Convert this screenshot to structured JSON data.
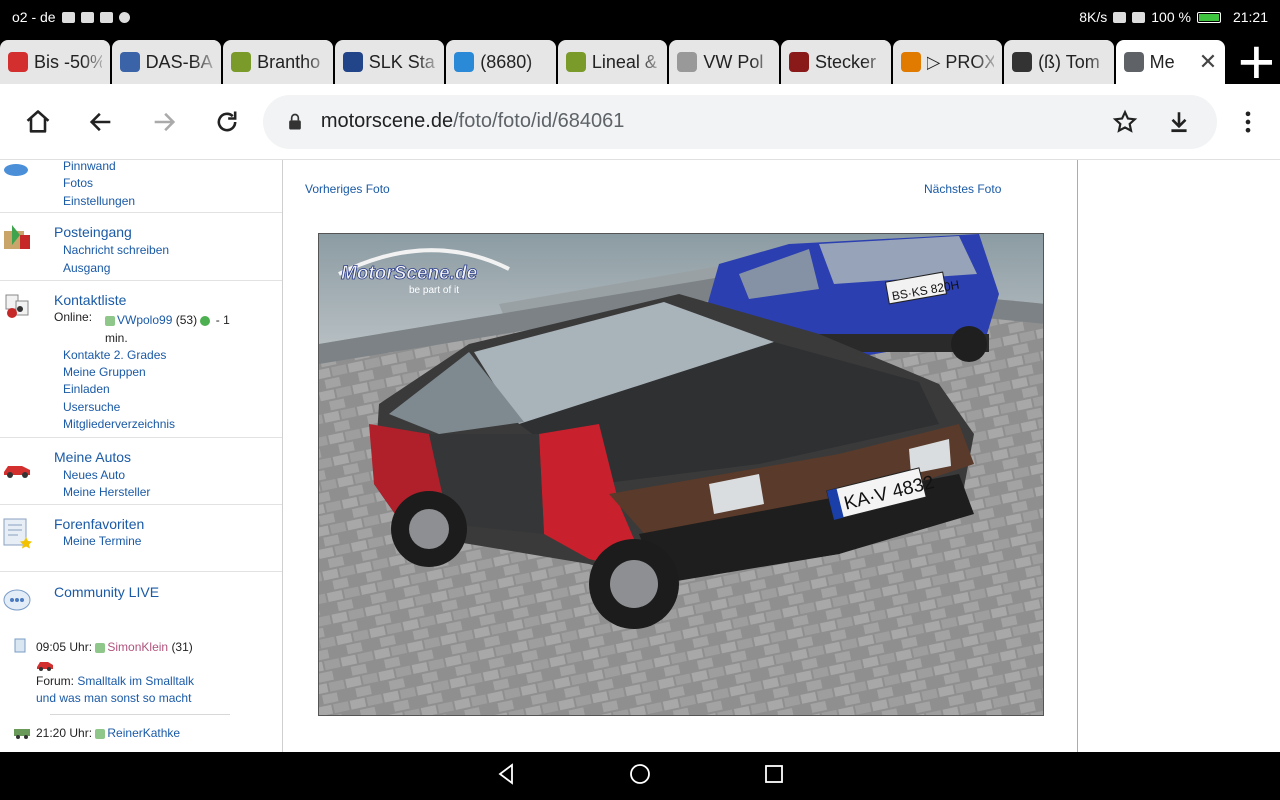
{
  "status": {
    "carrier": "o2 - de",
    "speed": "8K/s",
    "battery": "100 %",
    "time": "21:21"
  },
  "tabs": [
    {
      "title": "Bis -50%",
      "icon": "sale-icon",
      "color": "#d32f2f"
    },
    {
      "title": "DAS-BA",
      "icon": "ship-icon",
      "color": "#3a63a8"
    },
    {
      "title": "Brantho",
      "icon": "green-badge-icon",
      "color": "#7a9a2a"
    },
    {
      "title": "SLK Sta",
      "icon": "slk-icon",
      "color": "#224488"
    },
    {
      "title": "(8680)",
      "icon": "chat-icon",
      "color": "#2a8ad8"
    },
    {
      "title": "Lineal &",
      "icon": "green-badge-icon",
      "color": "#7a9a2a"
    },
    {
      "title": "VW Pol",
      "icon": "car-icon",
      "color": "#999999"
    },
    {
      "title": "Stecker",
      "icon": "xxl-icon",
      "color": "#8a1a1a"
    },
    {
      "title": "▷ PROX",
      "icon": "k-icon",
      "color": "#e07b00"
    },
    {
      "title": "(ß) Tom",
      "icon": "forum-icon",
      "color": "#333333"
    },
    {
      "title": "Me",
      "icon": "globe-icon",
      "color": "#5f6368"
    }
  ],
  "toolbar": {
    "url_host": "motorscene.de",
    "url_path": "/foto/foto/id/684061"
  },
  "sidebar": {
    "profile_links": [
      "Pinnwand",
      "Fotos",
      "Einstellungen"
    ],
    "posteingang": {
      "title": "Posteingang",
      "links": [
        "Nachricht schreiben",
        "Ausgang"
      ]
    },
    "kontakt": {
      "title": "Kontaktliste",
      "online_label": "Online:",
      "online_user": "VWpolo99",
      "online_age": "(53)",
      "online_suffix": "- 1",
      "online_min": "min.",
      "links": [
        "Kontakte 2. Grades",
        "Meine Gruppen",
        "Einladen",
        "Usersuche",
        "Mitgliederverzeichnis"
      ]
    },
    "autos": {
      "title": "Meine Autos",
      "links": [
        "Neues Auto",
        "Meine Hersteller"
      ]
    },
    "foren": {
      "title": "Forenfavoriten",
      "links": [
        "Meine Termine"
      ]
    },
    "community": {
      "title": "Community LIVE",
      "entry1_time": "09:05 Uhr:",
      "entry1_user": "SimonKlein",
      "entry1_age": "(31)",
      "entry1_forum_label": "Forum:",
      "entry1_forum_link": "Smalltalk im Smalltalk",
      "entry1_forum_link2": "und was man sonst so macht",
      "entry2_time": "21:20 Uhr:",
      "entry2_user": "ReinerKathke"
    }
  },
  "content": {
    "prev_label": "Vorheriges Foto",
    "next_label": "Nächstes Foto",
    "watermark_brand": "MotorScene.de",
    "watermark_tagline": "be part of it",
    "plate_front": "KA·V 4832",
    "plate_back": "BS·KS 820H"
  }
}
